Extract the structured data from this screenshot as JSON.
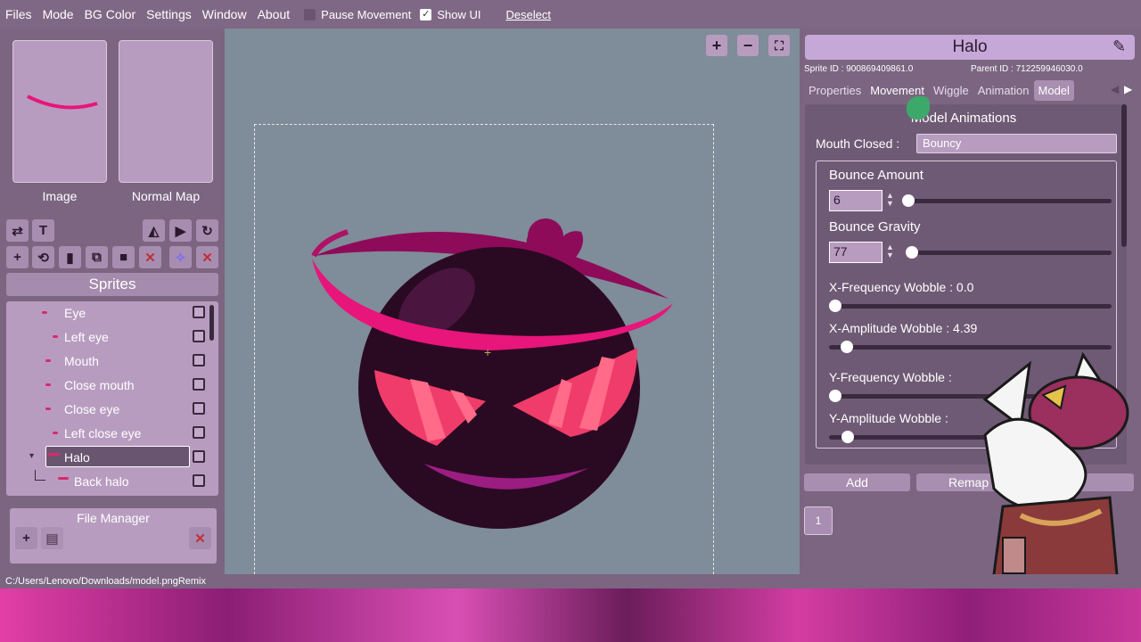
{
  "menu": {
    "items": [
      "Files",
      "Mode",
      "BG Color",
      "Settings",
      "Window",
      "About"
    ],
    "pause_label": "Pause Movement",
    "pause_checked": false,
    "showui_label": "Show UI",
    "showui_checked": true,
    "deselect_label": "Deselect"
  },
  "left": {
    "image_label": "Image",
    "normal_label": "Normal Map",
    "sprites_title": "Sprites",
    "sprites": [
      {
        "name": "Eye"
      },
      {
        "name": "Left eye"
      },
      {
        "name": "Mouth"
      },
      {
        "name": "Close mouth"
      },
      {
        "name": "Close eye"
      },
      {
        "name": "Left close eye"
      },
      {
        "name": "Halo"
      },
      {
        "name": "Back halo"
      }
    ],
    "file_manager_title": "File Manager"
  },
  "right": {
    "title": "Halo",
    "sprite_id": "Sprite ID : 900869409861.0",
    "parent_id": "Parent ID : 712259946030.0",
    "tabs": [
      "Properties",
      "Movement",
      "Wiggle",
      "Animation",
      "Model"
    ],
    "active_tab": "Model",
    "section_title": "Model Animations",
    "mouth_closed_label": "Mouth Closed :",
    "mouth_closed_value": "Bouncy",
    "bounce_amount_label": "Bounce Amount",
    "bounce_amount_value": "6",
    "bounce_gravity_label": "Bounce Gravity",
    "bounce_gravity_value": "77",
    "xfreq_label": "X-Frequency Wobble : 0.0",
    "xamp_label": "X-Amplitude Wobble : 4.39",
    "yfreq_label": "Y-Frequency Wobble :",
    "yamp_label": "Y-Amplitude Wobble :",
    "add_label": "Add",
    "remap_label": "Remap",
    "page_num": "1"
  },
  "status": {
    "path": "C:/Users/Lenovo/Downloads/model.pngRemix"
  },
  "colors": {
    "accent": "#c6a8d8",
    "halo": "#e8157a",
    "body": "#2a0a22"
  }
}
